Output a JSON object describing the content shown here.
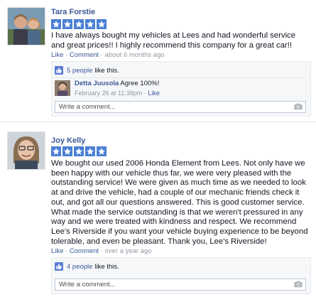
{
  "reviews": [
    {
      "author": "Tara Forstie",
      "rating": 5,
      "text": "I have always bought my vehicles at Lees and had wonderful service and great prices!! I highly recommend this company for a great car!!",
      "actions": {
        "like": "Like",
        "sep1": " · ",
        "comment": "Comment",
        "sep2": " · ",
        "time": "about 6 months ago"
      },
      "likes": {
        "count_text": "5 people",
        "suffix": "like this."
      },
      "reply": {
        "author": "Detta Juusola",
        "text": "Agree 100%!",
        "time": "February 26 at 11:38pm",
        "sep": " · ",
        "like": "Like"
      },
      "comment_placeholder": "Write a comment..."
    },
    {
      "author": "Joy Kelly",
      "rating": 5,
      "text": "We bought our used 2006 Honda Element from Lees. Not only have we been happy with our vehicle thus far, we were very pleased with the outstanding service! We were given as much time as we needed to look at and drive the vehicle, had a couple of our mechanic friends check it out, and got all our questions answered. This is good customer service. What made the service outstanding is that we weren't pressured in any way and we were treated with kindness and respect. We recommend Lee's Riverside if you want your vehicle buying experience to be beyond tolerable, and even be pleasant. Thank you, Lee's Riverside!",
      "actions": {
        "like": "Like",
        "sep1": " · ",
        "comment": "Comment",
        "sep2": " · ",
        "time": "over a year ago"
      },
      "likes": {
        "count_text": "4 people",
        "suffix": "like this."
      },
      "comment_placeholder": "Write a comment..."
    }
  ],
  "icons": {
    "star": "star-icon",
    "thumb": "thumbs-up-icon",
    "camera": "camera-icon"
  },
  "colors": {
    "link": "#3b5998",
    "star": "#4a7fd4",
    "meta": "#9197a3",
    "ufi_bg": "#f6f7f9"
  }
}
